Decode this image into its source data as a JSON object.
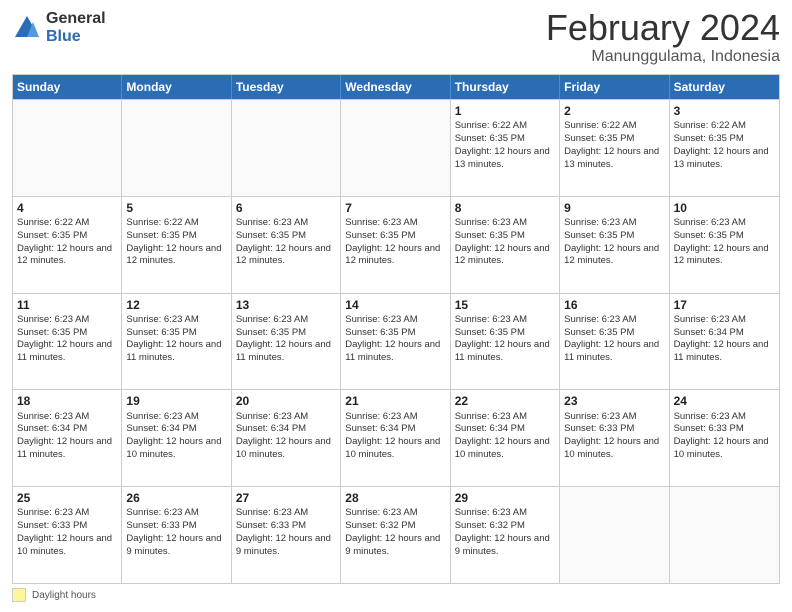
{
  "logo": {
    "general": "General",
    "blue": "Blue"
  },
  "title": {
    "month_year": "February 2024",
    "location": "Manunggulama, Indonesia"
  },
  "weekdays": [
    "Sunday",
    "Monday",
    "Tuesday",
    "Wednesday",
    "Thursday",
    "Friday",
    "Saturday"
  ],
  "legend": {
    "label": "Daylight hours"
  },
  "weeks": [
    [
      {
        "day": "",
        "sunrise": "",
        "sunset": "",
        "daylight": ""
      },
      {
        "day": "",
        "sunrise": "",
        "sunset": "",
        "daylight": ""
      },
      {
        "day": "",
        "sunrise": "",
        "sunset": "",
        "daylight": ""
      },
      {
        "day": "",
        "sunrise": "",
        "sunset": "",
        "daylight": ""
      },
      {
        "day": "1",
        "sunrise": "Sunrise: 6:22 AM",
        "sunset": "Sunset: 6:35 PM",
        "daylight": "Daylight: 12 hours and 13 minutes."
      },
      {
        "day": "2",
        "sunrise": "Sunrise: 6:22 AM",
        "sunset": "Sunset: 6:35 PM",
        "daylight": "Daylight: 12 hours and 13 minutes."
      },
      {
        "day": "3",
        "sunrise": "Sunrise: 6:22 AM",
        "sunset": "Sunset: 6:35 PM",
        "daylight": "Daylight: 12 hours and 13 minutes."
      }
    ],
    [
      {
        "day": "4",
        "sunrise": "Sunrise: 6:22 AM",
        "sunset": "Sunset: 6:35 PM",
        "daylight": "Daylight: 12 hours and 12 minutes."
      },
      {
        "day": "5",
        "sunrise": "Sunrise: 6:22 AM",
        "sunset": "Sunset: 6:35 PM",
        "daylight": "Daylight: 12 hours and 12 minutes."
      },
      {
        "day": "6",
        "sunrise": "Sunrise: 6:23 AM",
        "sunset": "Sunset: 6:35 PM",
        "daylight": "Daylight: 12 hours and 12 minutes."
      },
      {
        "day": "7",
        "sunrise": "Sunrise: 6:23 AM",
        "sunset": "Sunset: 6:35 PM",
        "daylight": "Daylight: 12 hours and 12 minutes."
      },
      {
        "day": "8",
        "sunrise": "Sunrise: 6:23 AM",
        "sunset": "Sunset: 6:35 PM",
        "daylight": "Daylight: 12 hours and 12 minutes."
      },
      {
        "day": "9",
        "sunrise": "Sunrise: 6:23 AM",
        "sunset": "Sunset: 6:35 PM",
        "daylight": "Daylight: 12 hours and 12 minutes."
      },
      {
        "day": "10",
        "sunrise": "Sunrise: 6:23 AM",
        "sunset": "Sunset: 6:35 PM",
        "daylight": "Daylight: 12 hours and 12 minutes."
      }
    ],
    [
      {
        "day": "11",
        "sunrise": "Sunrise: 6:23 AM",
        "sunset": "Sunset: 6:35 PM",
        "daylight": "Daylight: 12 hours and 11 minutes."
      },
      {
        "day": "12",
        "sunrise": "Sunrise: 6:23 AM",
        "sunset": "Sunset: 6:35 PM",
        "daylight": "Daylight: 12 hours and 11 minutes."
      },
      {
        "day": "13",
        "sunrise": "Sunrise: 6:23 AM",
        "sunset": "Sunset: 6:35 PM",
        "daylight": "Daylight: 12 hours and 11 minutes."
      },
      {
        "day": "14",
        "sunrise": "Sunrise: 6:23 AM",
        "sunset": "Sunset: 6:35 PM",
        "daylight": "Daylight: 12 hours and 11 minutes."
      },
      {
        "day": "15",
        "sunrise": "Sunrise: 6:23 AM",
        "sunset": "Sunset: 6:35 PM",
        "daylight": "Daylight: 12 hours and 11 minutes."
      },
      {
        "day": "16",
        "sunrise": "Sunrise: 6:23 AM",
        "sunset": "Sunset: 6:35 PM",
        "daylight": "Daylight: 12 hours and 11 minutes."
      },
      {
        "day": "17",
        "sunrise": "Sunrise: 6:23 AM",
        "sunset": "Sunset: 6:34 PM",
        "daylight": "Daylight: 12 hours and 11 minutes."
      }
    ],
    [
      {
        "day": "18",
        "sunrise": "Sunrise: 6:23 AM",
        "sunset": "Sunset: 6:34 PM",
        "daylight": "Daylight: 12 hours and 11 minutes."
      },
      {
        "day": "19",
        "sunrise": "Sunrise: 6:23 AM",
        "sunset": "Sunset: 6:34 PM",
        "daylight": "Daylight: 12 hours and 10 minutes."
      },
      {
        "day": "20",
        "sunrise": "Sunrise: 6:23 AM",
        "sunset": "Sunset: 6:34 PM",
        "daylight": "Daylight: 12 hours and 10 minutes."
      },
      {
        "day": "21",
        "sunrise": "Sunrise: 6:23 AM",
        "sunset": "Sunset: 6:34 PM",
        "daylight": "Daylight: 12 hours and 10 minutes."
      },
      {
        "day": "22",
        "sunrise": "Sunrise: 6:23 AM",
        "sunset": "Sunset: 6:34 PM",
        "daylight": "Daylight: 12 hours and 10 minutes."
      },
      {
        "day": "23",
        "sunrise": "Sunrise: 6:23 AM",
        "sunset": "Sunset: 6:33 PM",
        "daylight": "Daylight: 12 hours and 10 minutes."
      },
      {
        "day": "24",
        "sunrise": "Sunrise: 6:23 AM",
        "sunset": "Sunset: 6:33 PM",
        "daylight": "Daylight: 12 hours and 10 minutes."
      }
    ],
    [
      {
        "day": "25",
        "sunrise": "Sunrise: 6:23 AM",
        "sunset": "Sunset: 6:33 PM",
        "daylight": "Daylight: 12 hours and 10 minutes."
      },
      {
        "day": "26",
        "sunrise": "Sunrise: 6:23 AM",
        "sunset": "Sunset: 6:33 PM",
        "daylight": "Daylight: 12 hours and 9 minutes."
      },
      {
        "day": "27",
        "sunrise": "Sunrise: 6:23 AM",
        "sunset": "Sunset: 6:33 PM",
        "daylight": "Daylight: 12 hours and 9 minutes."
      },
      {
        "day": "28",
        "sunrise": "Sunrise: 6:23 AM",
        "sunset": "Sunset: 6:32 PM",
        "daylight": "Daylight: 12 hours and 9 minutes."
      },
      {
        "day": "29",
        "sunrise": "Sunrise: 6:23 AM",
        "sunset": "Sunset: 6:32 PM",
        "daylight": "Daylight: 12 hours and 9 minutes."
      },
      {
        "day": "",
        "sunrise": "",
        "sunset": "",
        "daylight": ""
      },
      {
        "day": "",
        "sunrise": "",
        "sunset": "",
        "daylight": ""
      }
    ]
  ]
}
